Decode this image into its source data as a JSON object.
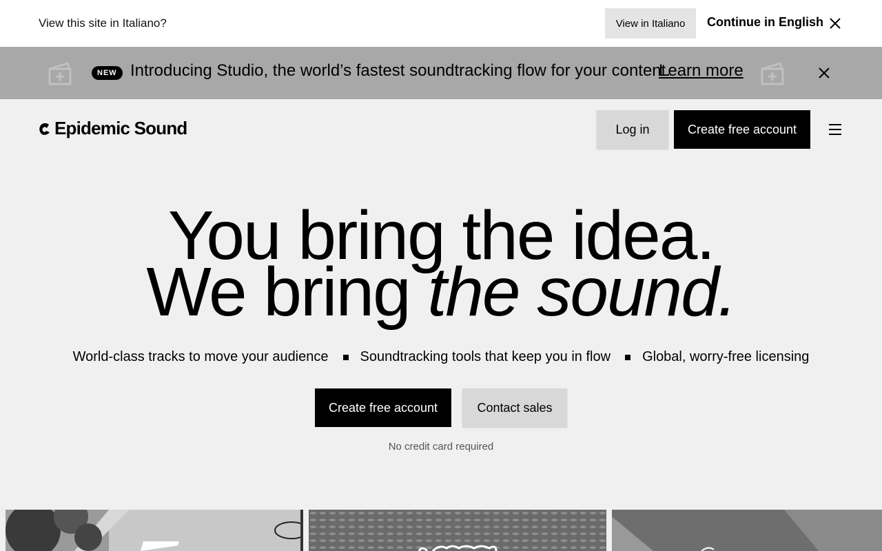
{
  "language_bar": {
    "prompt": "View this site in Italiano?",
    "view_button": "View in Italiano",
    "continue_link": "Continue in English",
    "close_icon": "close-icon"
  },
  "announcement": {
    "badge": "NEW",
    "text": "Introducing Studio, the world’s fastest soundtracking flow for your content.",
    "link": "Learn more",
    "decoration_icon": "clapperboard-icon",
    "close_icon": "close-icon"
  },
  "header": {
    "logo_text": "Epidemic Sound",
    "login_label": "Log in",
    "create_account_label": "Create free account",
    "menu_icon": "hamburger-menu-icon"
  },
  "hero": {
    "line1": "You bring the idea.",
    "line2_prefix": "We bring ",
    "line2_italic": "the sound.",
    "features": [
      "World-class tracks to move your audience",
      "Soundtracking tools that keep you in flow",
      "Global, worry-free licensing"
    ],
    "create_account_label": "Create free account",
    "contact_sales_label": "Contact sales",
    "note": "No credit card required"
  },
  "colors": {
    "announcement_bg": "#a8a8a8",
    "page_bg": "#f0f0f0",
    "primary_button_bg": "#000000",
    "secondary_button_bg": "#d8d8d8"
  }
}
